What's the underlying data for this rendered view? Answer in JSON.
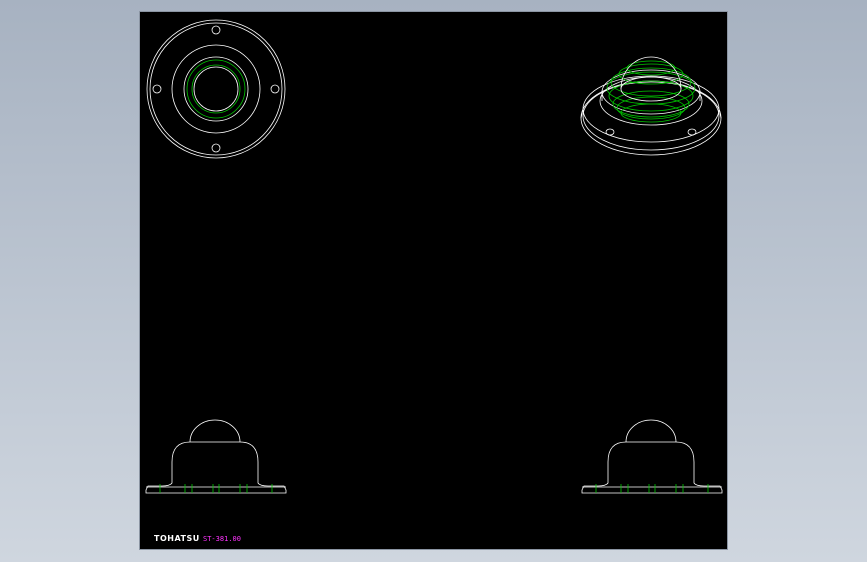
{
  "drawing": {
    "brand_label": "TOHATSU",
    "part_number": "ST-381.00",
    "colors": {
      "background": "#000000",
      "outline": "#ffffff",
      "hidden_line": "#00c800",
      "part_number_text": "#ff33ff",
      "window_backdrop": "#b3bdca"
    }
  }
}
